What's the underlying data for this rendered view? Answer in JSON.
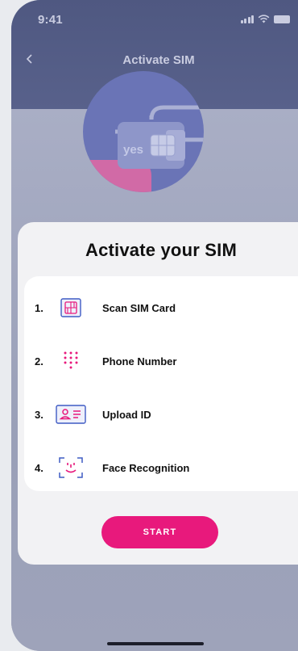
{
  "status_bar": {
    "time": "9:41"
  },
  "header": {
    "back_icon": "chevron-left-icon",
    "title": "Activate SIM"
  },
  "hero": {
    "brand_text": "yes"
  },
  "card": {
    "title": "Activate your SIM",
    "steps": [
      {
        "number": "1.",
        "label": "Scan SIM Card",
        "icon": "sim-card-icon"
      },
      {
        "number": "2.",
        "label": "Phone Number",
        "icon": "keypad-icon"
      },
      {
        "number": "3.",
        "label": "Upload ID",
        "icon": "id-card-icon"
      },
      {
        "number": "4.",
        "label": "Face Recognition",
        "icon": "face-scan-icon"
      }
    ],
    "start_label": "START"
  },
  "colors": {
    "accent": "#e8197c",
    "icon_blue": "#3f5bc4",
    "header_bg": "#4f5881"
  }
}
